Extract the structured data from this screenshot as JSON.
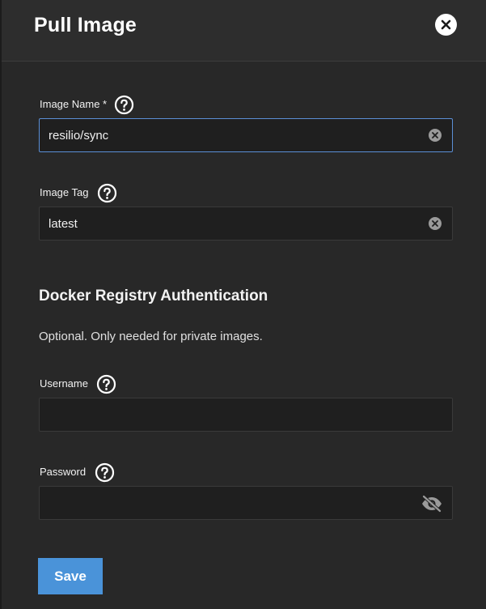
{
  "dialog": {
    "title": "Pull Image",
    "close_icon": "close-icon"
  },
  "fields": {
    "image_name": {
      "label": "Image Name *",
      "value": "resilio/sync",
      "help_icon": "help-icon",
      "clear_icon": "clear-icon"
    },
    "image_tag": {
      "label": "Image Tag",
      "value": "latest",
      "help_icon": "help-icon",
      "clear_icon": "clear-icon"
    }
  },
  "auth_section": {
    "title": "Docker Registry Authentication",
    "description": "Optional. Only needed for private images.",
    "username": {
      "label": "Username",
      "value": "",
      "help_icon": "help-icon"
    },
    "password": {
      "label": "Password",
      "value": "",
      "help_icon": "help-icon",
      "visibility_icon": "eye-off-icon"
    }
  },
  "actions": {
    "save_label": "Save"
  },
  "colors": {
    "background": "#282828",
    "header": "#2d2d2d",
    "field_bg": "#1f1f1f",
    "focus_border": "#5b8fd6",
    "primary": "#4a93d9"
  }
}
